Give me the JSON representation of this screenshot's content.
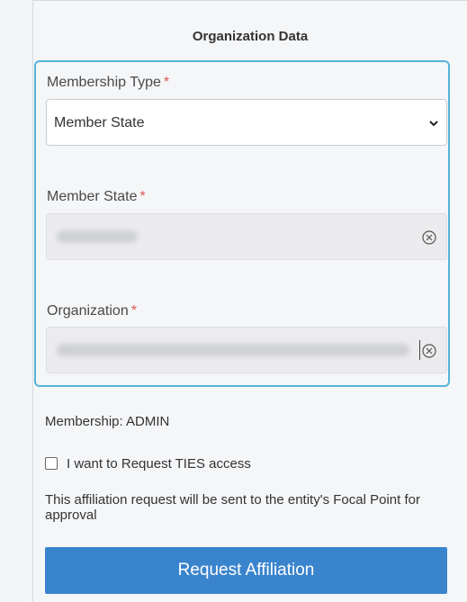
{
  "panel": {
    "title": "Organization Data"
  },
  "form": {
    "membership_type": {
      "label": "Membership Type",
      "required_mark": "*",
      "value": "Member State"
    },
    "member_state": {
      "label": "Member State",
      "required_mark": "*"
    },
    "organization": {
      "label": "Organization",
      "required_mark": "*"
    }
  },
  "membership_text": "Membership: ADMIN",
  "ties_checkbox": {
    "label": "I want to Request TIES access",
    "checked": false
  },
  "note": "This affiliation request will be sent to the entity's Focal Point for approval",
  "submit_label": "Request Affiliation",
  "colors": {
    "accent_border": "#55b4d6",
    "button": "#3a84cd",
    "required": "#d9534f"
  },
  "icons": [
    "chevron-down-icon",
    "clear-circle-x-icon"
  ]
}
